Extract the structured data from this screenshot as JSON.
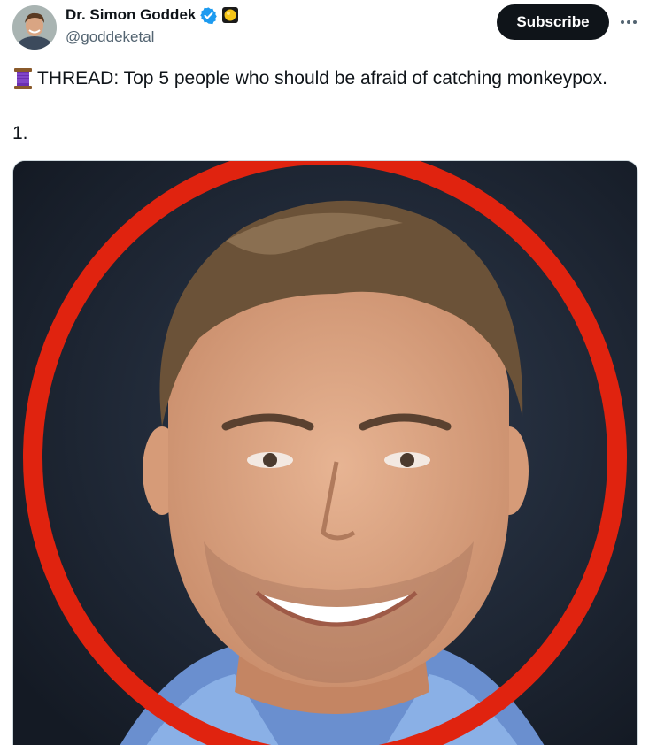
{
  "author": {
    "display_name": "Dr. Simon Goddek",
    "handle": "@goddeketal",
    "avatar_icon": "avatar-photo",
    "verified_icon": "verified-badge-icon",
    "affiliation_icon": "affiliation-badge-icon"
  },
  "actions": {
    "subscribe_label": "Subscribe",
    "more_icon": "more-icon"
  },
  "tweet": {
    "emoji_icon": "thread-spool-icon",
    "line1": "THREAD: Top 5 people who should be afraid of catching monkeypox.",
    "line2": "1."
  },
  "media": {
    "alt": "",
    "ring_color": "#e0230f",
    "background_color": "#1c2433"
  },
  "colors": {
    "text_primary": "#0f1419",
    "text_secondary": "#536471",
    "verified_blue": "#1d9bf0",
    "button_bg": "#0f1419"
  }
}
